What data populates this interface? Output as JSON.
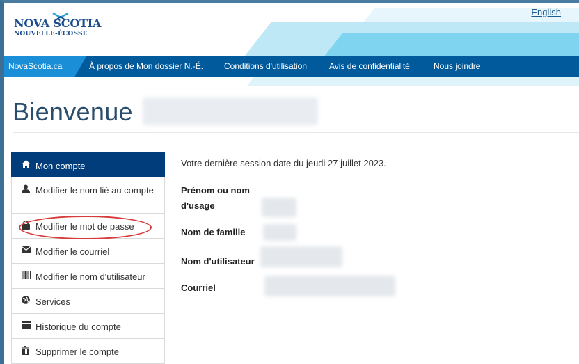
{
  "header": {
    "english_link": "English",
    "logo_line1": "NOVA SCOTIA",
    "logo_line2": "NOUVELLE-ÉCOSSE"
  },
  "nav": {
    "items": [
      "NovaScotia.ca",
      "À propos de Mon dossier N.-É.",
      "Conditions d'utilisation",
      "Avis de confidentialité",
      "Nous joindre"
    ]
  },
  "page": {
    "title": "Bienvenue"
  },
  "sidebar": {
    "items": [
      {
        "label": "Mon compte",
        "icon": "home-icon"
      },
      {
        "label": "Modifier le nom lié au compte",
        "icon": "user-icon"
      },
      {
        "label": "Modifier le mot de passe",
        "icon": "lock-icon"
      },
      {
        "label": "Modifier le courriel",
        "icon": "envelope-icon"
      },
      {
        "label": "Modifier le nom d'utilisateur",
        "icon": "barcode-icon"
      },
      {
        "label": "Services",
        "icon": "globe-icon"
      },
      {
        "label": "Historique du compte",
        "icon": "list-icon"
      },
      {
        "label": "Supprimer le compte",
        "icon": "trash-icon"
      }
    ]
  },
  "account": {
    "last_session": "Votre dernière session date du jeudi 27 juillet 2023.",
    "first_name_label_line1": "Prénom ou nom",
    "first_name_label_line2": "d'usage",
    "last_name_label": "Nom de famille",
    "username_label": "Nom d'utilisateur",
    "email_label": "Courriel"
  },
  "colors": {
    "nav_bg": "#005a9c",
    "nav_home_bg": "#1a8ed6",
    "sidebar_active_bg": "#003d7a",
    "highlight": "#d63a3a",
    "title": "#2a4d6b"
  }
}
